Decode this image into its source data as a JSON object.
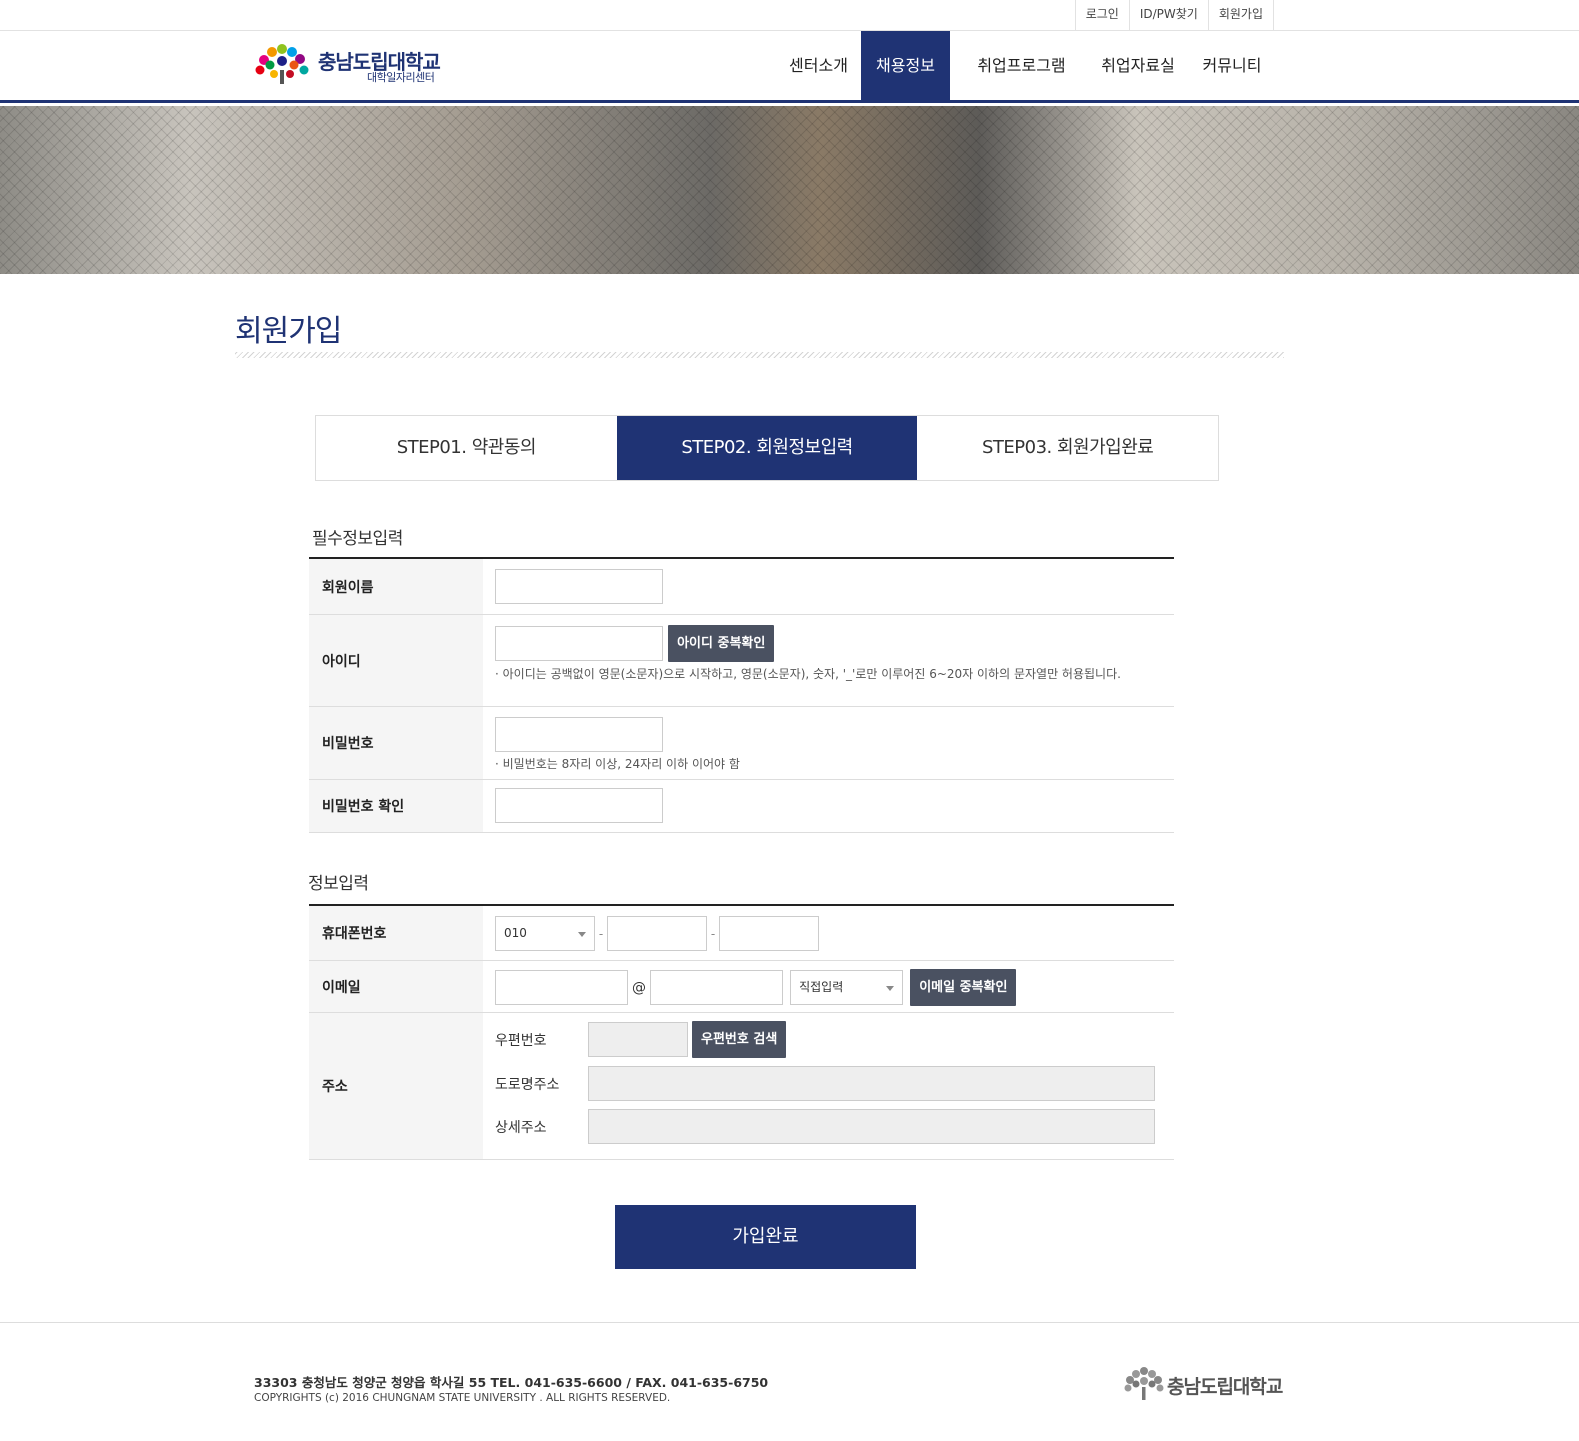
{
  "util": {
    "login": "로그인",
    "find": "ID/PW찾기",
    "join": "회원가입"
  },
  "logo": {
    "name": "충남도립대학교",
    "sub": "대학일자리센터"
  },
  "gnb": [
    "센터소개",
    "채용정보",
    "취업프로그램",
    "취업자료실",
    "커뮤니티"
  ],
  "page_title": "회원가입",
  "steps": [
    "STEP01. 약관동의",
    "STEP02. 회원정보입력",
    "STEP03. 회원가입완료"
  ],
  "required": {
    "title": "필수정보입력",
    "name_label": "회원이름",
    "id_label": "아이디",
    "id_button": "아이디 중복확인",
    "id_help": "· 아이디는 공백없이 영문(소문자)으로 시작하고, 영문(소문자), 숫자, '_'로만 이루어진 6~20자 이하의 문자열만 허용됩니다.",
    "pw_label": "비밀번호",
    "pw_help": "· 비밀번호는 8자리 이상, 24자리 이하 이어야 함",
    "pw_confirm_label": "비밀번호 확인"
  },
  "info": {
    "title": "정보입력",
    "phone_label": "휴대폰번호",
    "phone_prefix": "010",
    "phone_sep": "-",
    "email_label": "이메일",
    "email_at": "@",
    "email_domain_select": "직접입력",
    "email_button": "이메일 중복확인",
    "address_label": "주소",
    "zip_label": "우편번호",
    "zip_button": "우편번호 검색",
    "road_label": "도로명주소",
    "detail_label": "상세주소"
  },
  "submit_label": "가입완료",
  "footer": {
    "address": "33303  충청남도 청양군 청양읍 학사길 55  TEL. 041-635-6600  /  FAX. 041-635-6750",
    "copyright": "COPYRIGHTS (c) 2016  CHUNGNAM STATE UNIVERSITY . ALL RIGHTS RESERVED.",
    "logo_name": "충남도립대학교"
  },
  "colors": {
    "primary": "#1f3374",
    "button_dark": "#4a5161"
  }
}
